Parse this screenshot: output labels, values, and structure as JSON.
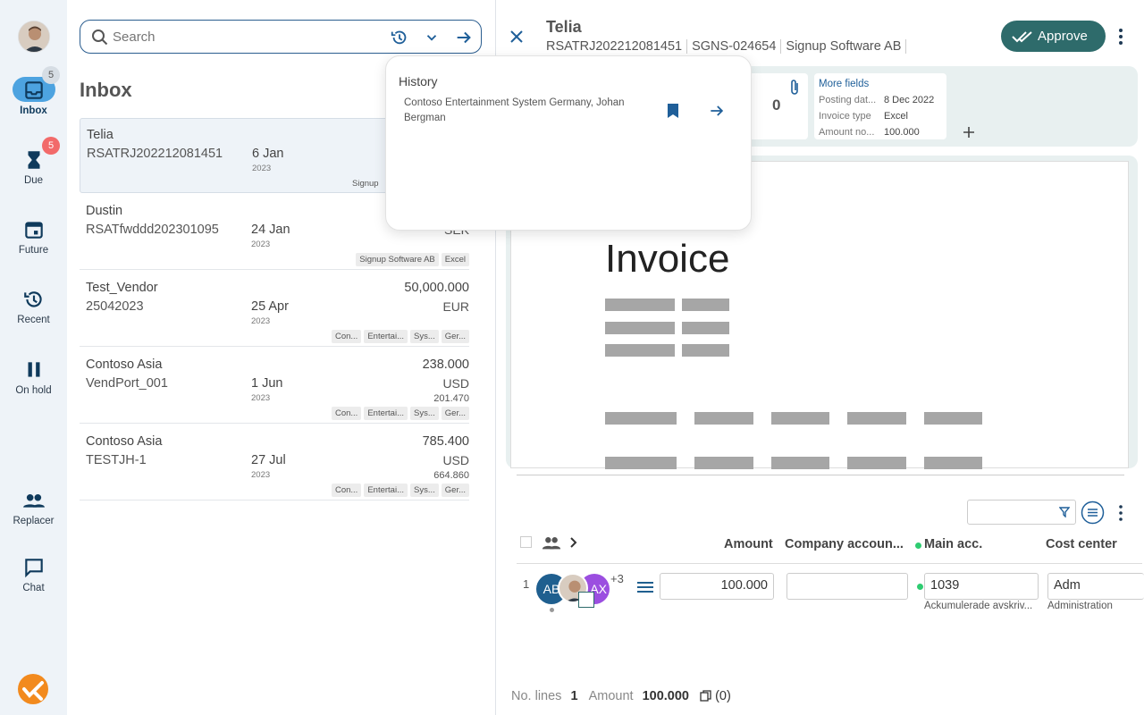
{
  "nav": {
    "items": [
      {
        "label": "Inbox",
        "badge": "5"
      },
      {
        "label": "Due",
        "badge": "5"
      },
      {
        "label": "Future"
      },
      {
        "label": "Recent"
      },
      {
        "label": "On hold"
      },
      {
        "label": "Replacer"
      },
      {
        "label": "Chat"
      }
    ]
  },
  "search": {
    "placeholder": "Search"
  },
  "inbox": {
    "title": "Inbox",
    "rows": [
      {
        "vendor": "Telia",
        "invno": "RSATRJ202212081451",
        "date": "6 Jan",
        "year": "2023",
        "tags": [
          "Signup"
        ]
      },
      {
        "vendor": "Dustin",
        "invno": "RSATfwddd202301095",
        "date": "24 Jan",
        "year": "2023",
        "currency": "SEK",
        "tags": [
          "Signup Software AB",
          "Excel"
        ]
      },
      {
        "vendor": "Test_Vendor",
        "invno": "25042023",
        "date": "25 Apr",
        "year": "2023",
        "amount": "50,000.000",
        "currency": "EUR",
        "tags": [
          "Con...",
          "Entertai...",
          "Sys...",
          "Ger..."
        ]
      },
      {
        "vendor": "Contoso Asia",
        "invno": "VendPort_001",
        "date": "1 Jun",
        "year": "2023",
        "amount": "238.000",
        "currency": "USD",
        "subamt": "201.470",
        "tags": [
          "Con...",
          "Entertai...",
          "Sys...",
          "Ger..."
        ]
      },
      {
        "vendor": "Contoso Asia",
        "invno": "TESTJH-1",
        "date": "27 Jul",
        "year": "2023",
        "amount": "785.400",
        "currency": "USD",
        "subamt": "664.860",
        "tags": [
          "Con...",
          "Entertai...",
          "Sys...",
          "Ger..."
        ]
      }
    ]
  },
  "history": {
    "title": "History",
    "entry": "Contoso Entertainment System Germany, Johan Bergman"
  },
  "detail": {
    "vendor": "Telia",
    "invno": "RSATRJ202212081451",
    "ref": "SGNS-024654",
    "company": "Signup Software AB",
    "approve_label": "Approve",
    "attachments_count": "0",
    "more_fields": {
      "title": "More fields",
      "rows": [
        {
          "label": "Posting dat...",
          "value": "8 Dec 2022"
        },
        {
          "label": "Invoice type",
          "value": "Excel"
        },
        {
          "label": "Amount no...",
          "value": "100.000"
        }
      ]
    },
    "doc_title": "Invoice",
    "grid": {
      "headers": {
        "amount": "Amount",
        "company_account": "Company accoun...",
        "main_acc": "Main acc.",
        "cost_center": "Cost center"
      },
      "line_no": "1",
      "avatar_initials": [
        "AB",
        "AX"
      ],
      "more_users": "+3",
      "amount": "100.000",
      "main_acc": "1039",
      "main_acc_desc": "Ackumulerade avskriv...",
      "cost_center": "Adm",
      "cost_center_desc": "Administration"
    },
    "footer": {
      "lines_label": "No. lines",
      "lines_value": "1",
      "amount_label": "Amount",
      "amount_value": "100.000",
      "copies": "(0)"
    }
  },
  "colors": {
    "accent": "#2e6b6b",
    "nav_bg": "#eef3f8",
    "badge_red": "#f26a6a",
    "link_blue": "#1f5f99"
  }
}
